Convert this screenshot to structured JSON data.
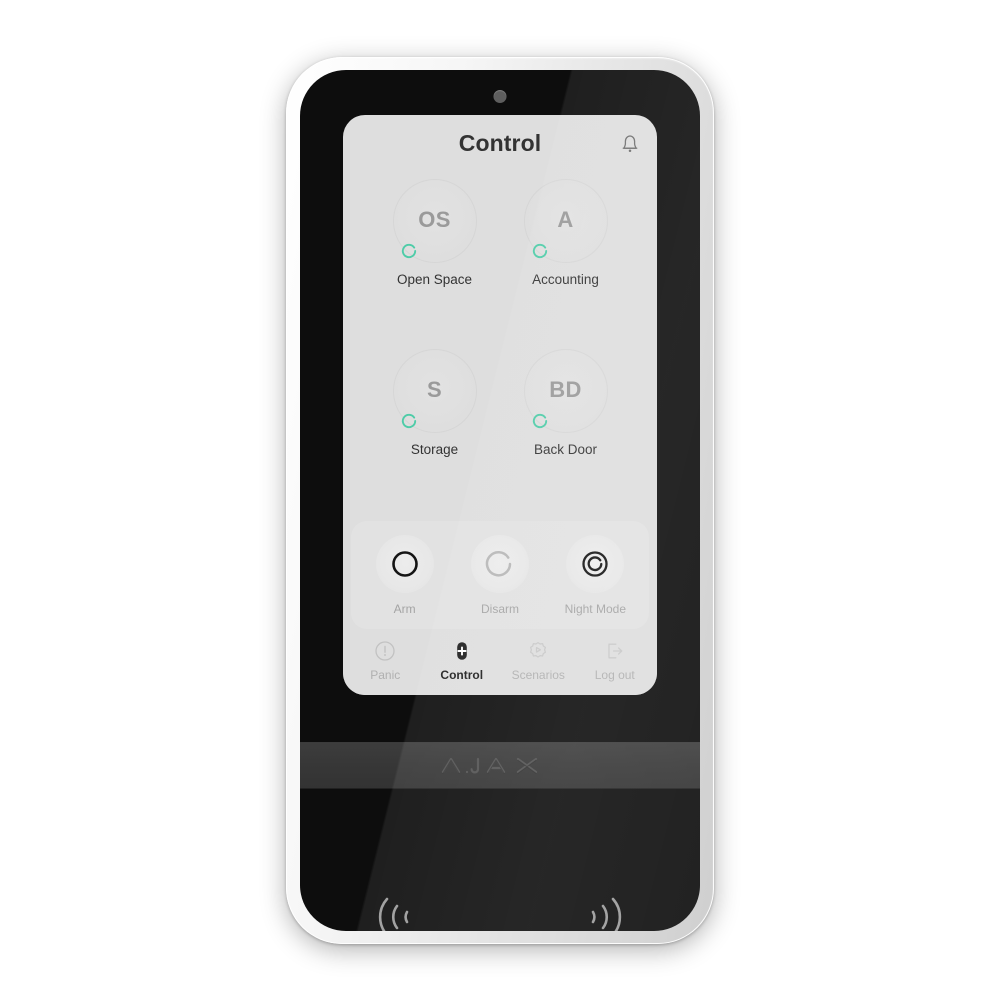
{
  "device": {
    "brand": "AJAX",
    "sensor": "proximity-sensor",
    "readers": [
      {
        "name": "rfid-reader-left",
        "icon": "rfid-waves-right-icon"
      },
      {
        "name": "rfid-reader-right",
        "icon": "rfid-waves-left-icon"
      }
    ]
  },
  "screen": {
    "header": {
      "title": "Control",
      "bell_icon": "bell-icon"
    },
    "groups": [
      {
        "initials": "OS",
        "label": "Open Space",
        "status": "disarmed",
        "status_color": "#4ecca8"
      },
      {
        "initials": "A",
        "label": "Accounting",
        "status": "disarmed",
        "status_color": "#4ecca8"
      },
      {
        "initials": "S",
        "label": "Storage",
        "status": "disarmed",
        "status_color": "#4ecca8"
      },
      {
        "initials": "BD",
        "label": "Back Door",
        "status": "disarmed",
        "status_color": "#4ecca8"
      }
    ],
    "actions": [
      {
        "label": "Arm",
        "icon": "arm-ring-icon",
        "state": "enabled"
      },
      {
        "label": "Disarm",
        "icon": "disarm-arc-icon",
        "state": "inactive"
      },
      {
        "label": "Night Mode",
        "icon": "night-mode-icon",
        "state": "enabled"
      }
    ],
    "nav": [
      {
        "label": "Panic",
        "icon": "panic-exclamation-icon",
        "active": false
      },
      {
        "label": "Control",
        "icon": "control-plus-icon",
        "active": true
      },
      {
        "label": "Scenarios",
        "icon": "scenarios-gear-icon",
        "active": false
      },
      {
        "label": "Log out",
        "icon": "logout-arrow-icon",
        "active": false
      }
    ]
  },
  "colors": {
    "accent_green": "#4ecca8",
    "screen_bg": "#dedede",
    "text_primary": "#333333",
    "text_muted": "#b0b0b0"
  }
}
